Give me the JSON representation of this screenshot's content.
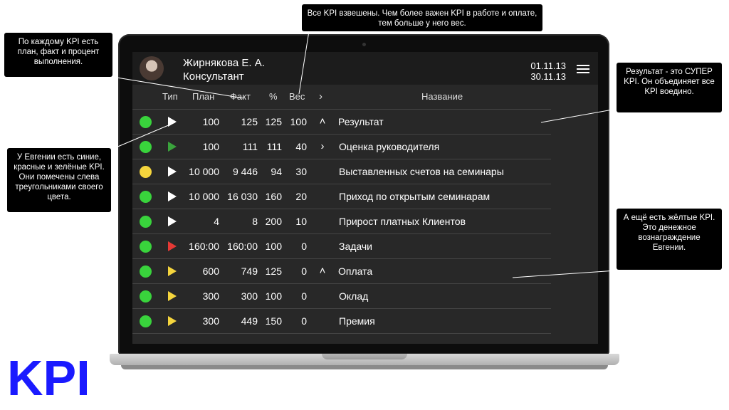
{
  "callouts": {
    "top": "Все KPI взвешены. Чем более важен KPI в работе и оплате, тем больше у него вес.",
    "left_top": "По каждому KPI есть план, факт и процент выполнения.",
    "left_mid": "У Евгении есть синие, красные и зелёные KPI. Они помечены слева треугольниками своего цвета.",
    "right_top": "Результат - это СУПЕР KPI. Он объединяет все KPI воедино.",
    "right_mid": "А ещё есть жёлтые KPI. Это денежное вознаграждение Евгении."
  },
  "header": {
    "name": "Жирнякова Е. А.",
    "role": "Консультант",
    "date_from": "01.11.13",
    "date_to": "30.11.13"
  },
  "columns": {
    "type": "Тип",
    "plan": "План",
    "fact": "Факт",
    "pct": "%",
    "weight": "Вес",
    "expand": "›",
    "name": "Название"
  },
  "colors": {
    "green": "#39d33c",
    "yellow": "#f5d53d",
    "tri_white": "#ffffff",
    "tri_green": "#3aa33c",
    "tri_red": "#e53935",
    "tri_yellow": "#f5d53d"
  },
  "rows": [
    {
      "status": "green",
      "tri": "tri_white",
      "plan": "100",
      "fact": "125",
      "pct": "125",
      "weight": "100",
      "expand": "˄",
      "name": "Результат",
      "top": true
    },
    {
      "status": "green",
      "tri": "tri_green",
      "plan": "100",
      "fact": "111",
      "pct": "111",
      "weight": "40",
      "expand": "›",
      "name": "Оценка руководителя",
      "top": false
    },
    {
      "status": "yellow",
      "tri": "tri_white",
      "plan": "10 000",
      "fact": "9 446",
      "pct": "94",
      "weight": "30",
      "expand": "",
      "name": "Выставленных счетов на семинары",
      "top": false
    },
    {
      "status": "green",
      "tri": "tri_white",
      "plan": "10 000",
      "fact": "16 030",
      "pct": "160",
      "weight": "20",
      "expand": "",
      "name": "Приход по открытым семинарам",
      "top": false
    },
    {
      "status": "green",
      "tri": "tri_white",
      "plan": "4",
      "fact": "8",
      "pct": "200",
      "weight": "10",
      "expand": "",
      "name": "Прирост платных Клиентов",
      "top": false
    },
    {
      "status": "green",
      "tri": "tri_red",
      "plan": "160:00",
      "fact": "160:00",
      "pct": "100",
      "weight": "0",
      "expand": "",
      "name": "Задачи",
      "top": false
    },
    {
      "status": "green",
      "tri": "tri_yellow",
      "plan": "600",
      "fact": "749",
      "pct": "125",
      "weight": "0",
      "expand": "˄",
      "name": "Оплата",
      "top": true
    },
    {
      "status": "green",
      "tri": "tri_yellow",
      "plan": "300",
      "fact": "300",
      "pct": "100",
      "weight": "0",
      "expand": "",
      "name": "Оклад",
      "top": false
    },
    {
      "status": "green",
      "tri": "tri_yellow",
      "plan": "300",
      "fact": "449",
      "pct": "150",
      "weight": "0",
      "expand": "",
      "name": "Премия",
      "top": false
    }
  ],
  "logo": "KPI"
}
